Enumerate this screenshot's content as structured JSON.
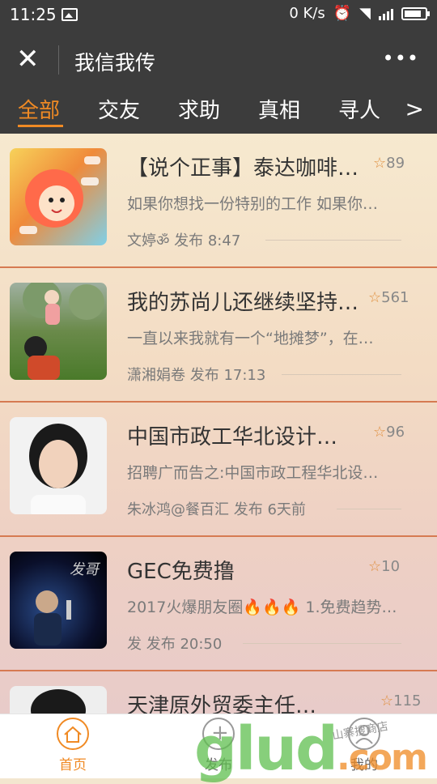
{
  "status": {
    "time": "11:25",
    "net_speed": "0 K/s"
  },
  "titlebar": {
    "title": "我信我传"
  },
  "tabs": [
    {
      "label": "全部"
    },
    {
      "label": "交友"
    },
    {
      "label": "求助"
    },
    {
      "label": "真相"
    },
    {
      "label": "寻人"
    }
  ],
  "feed": [
    {
      "title": "【说个正事】泰达咖啡…",
      "stars": "89",
      "snippet": "如果你想找一份特别的工作 如果你…",
      "meta": "文婷ॐ 发布 8:47"
    },
    {
      "title": "我的苏尚儿还继续坚持…",
      "stars": "561",
      "snippet": "一直以来我就有一个“地摊梦”，在…",
      "meta": "潇湘娟卷 发布 17:13"
    },
    {
      "title": "中国市政工华北设计…",
      "stars": "96",
      "snippet": "招聘广而告之:中国市政工程华北设…",
      "meta": "朱冰鸿@餐百汇 发布 6天前"
    },
    {
      "title": "GEC免费撸",
      "stars": "10",
      "snippet": "2017火爆朋友圈🔥🔥🔥 1.免费趋势…",
      "meta": "发 发布 20:50",
      "thumb_text": "发哥"
    },
    {
      "title": "天津原外贸委主任…",
      "stars": "115",
      "snippet": "",
      "meta": ""
    }
  ],
  "nav": [
    {
      "label": "首页"
    },
    {
      "label": "发布"
    },
    {
      "label": "我的"
    }
  ],
  "watermark": {
    "main": "glud",
    "suffix": ".com",
    "sub": "山寨搜商店"
  }
}
